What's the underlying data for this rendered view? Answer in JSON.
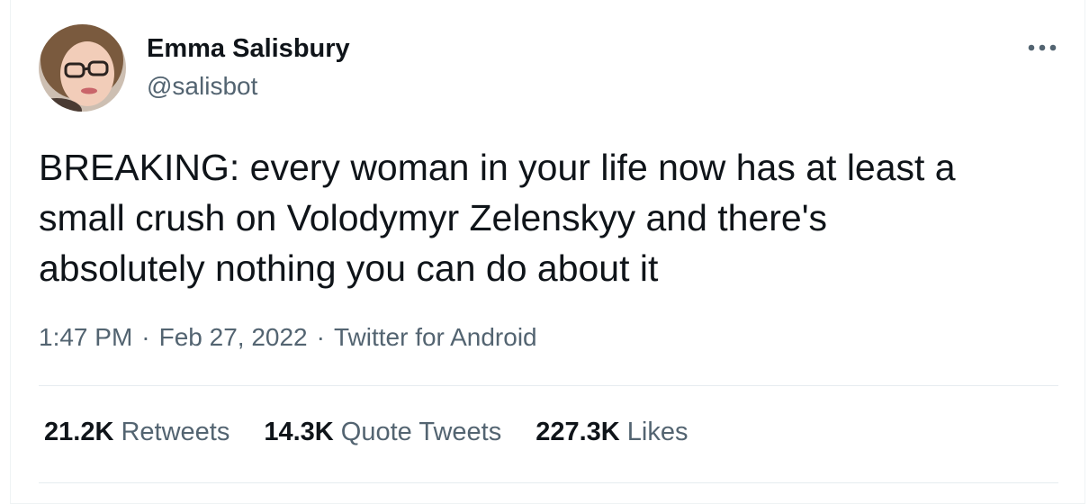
{
  "author": {
    "name": "Emma Salisbury",
    "handle": "@salisbot"
  },
  "tweet": {
    "text": "BREAKING: every woman in your life now has at least a\nsmall crush on Volodymyr Zelenskyy and there's\nabsolutely nothing you can do about it",
    "time": "1:47 PM",
    "date": "Feb 27, 2022",
    "source": "Twitter for Android",
    "separator": "·"
  },
  "stats": [
    {
      "count": "21.2K",
      "label": "Retweets"
    },
    {
      "count": "14.3K",
      "label": "Quote Tweets"
    },
    {
      "count": "227.3K",
      "label": "Likes"
    }
  ],
  "icons": {
    "more": "more-horizontal-icon"
  },
  "colors": {
    "text_primary": "#0f1419",
    "text_secondary": "#536471",
    "divider": "#e6ecf0"
  }
}
